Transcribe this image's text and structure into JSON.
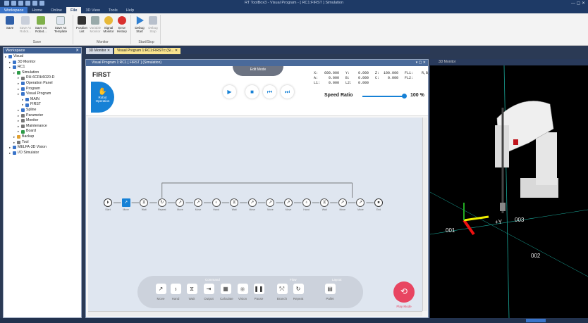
{
  "app": {
    "title": "RT ToolBox3 - Visual Program - [ RC1:FIRST ] Simulation",
    "menu_tabs": [
      "Workspace",
      "Home",
      "Online",
      "File",
      "3D View",
      "Tools",
      "Help"
    ]
  },
  "ribbon": {
    "groups": [
      {
        "label": "Save",
        "buttons": [
          "Save",
          "Save As Robot...",
          "Save As Robot...",
          "Save As Template"
        ]
      },
      {
        "label": "Monitor",
        "buttons": [
          "Position List",
          "Variable Monitor",
          "Signal Monitor",
          "Error History"
        ]
      },
      {
        "label": "Start/Stop",
        "buttons": [
          "Debug Start",
          "Debug Stop"
        ]
      }
    ]
  },
  "workspace": {
    "title": "Workspace",
    "tree": [
      {
        "label": "Visual",
        "depth": 0,
        "icon_color": "#3a74c9"
      },
      {
        "label": "3D Monitor",
        "depth": 1,
        "icon_color": "#3a74c9"
      },
      {
        "label": "RC1",
        "depth": 1,
        "icon_color": "#3a74c9"
      },
      {
        "label": "Simulation",
        "depth": 2,
        "icon_color": "#2e9b48"
      },
      {
        "label": "RH-6CRH6020-D",
        "depth": 3,
        "icon_color": "#777"
      },
      {
        "label": "Operation Panel",
        "depth": 3,
        "icon_color": "#3a74c9"
      },
      {
        "label": "Program",
        "depth": 3,
        "icon_color": "#3a74c9"
      },
      {
        "label": "Visual Program",
        "depth": 3,
        "icon_color": "#3a74c9"
      },
      {
        "label": "MAIN",
        "depth": 4,
        "icon_color": "#3a74c9"
      },
      {
        "label": "FIRST",
        "depth": 4,
        "icon_color": "#3a74c9"
      },
      {
        "label": "Spline",
        "depth": 3,
        "icon_color": "#3a74c9"
      },
      {
        "label": "Parameter",
        "depth": 3,
        "icon_color": "#777"
      },
      {
        "label": "Monitor",
        "depth": 3,
        "icon_color": "#777"
      },
      {
        "label": "Maintenance",
        "depth": 3,
        "icon_color": "#777"
      },
      {
        "label": "Board",
        "depth": 3,
        "icon_color": "#2e9b48"
      },
      {
        "label": "Backup",
        "depth": 2,
        "icon_color": "#e0a030"
      },
      {
        "label": "Tool",
        "depth": 2,
        "icon_color": "#777"
      },
      {
        "label": "MELFA-3D Vision",
        "depth": 1,
        "icon_color": "#3a74c9"
      },
      {
        "label": "I/O Simulator",
        "depth": 1,
        "icon_color": "#3a74c9"
      }
    ]
  },
  "doc_tabs": [
    {
      "label": "3D Monitor",
      "active": false
    },
    {
      "label": "Visual Program 1:RC1:FIRST:c (Si...",
      "active": true
    }
  ],
  "right_pane": {
    "title": "3D Monitor"
  },
  "visual_program": {
    "panel_title": "Visual Program 1:RC1 [ FIRST ] (Simulation)",
    "program_name": "FIRST",
    "mode": "Edit Mode",
    "robot_operation": "Robot Operation",
    "coords": "X:   600.000   Y:    0.000   Z:  100.000   FL1:    R,B,F\nA:     0.000   B:    0.000   C:    0.000   FL2:        0\nL1:    0.000   L2:   0.000",
    "speed_label": "Speed Ratio",
    "speed_ratio": 100,
    "speed_text": "100 %"
  },
  "flowchart": {
    "nodes": [
      {
        "glyph": "⏵",
        "label": "Start",
        "kind": "term"
      },
      {
        "glyph": "↗",
        "label": "Move",
        "kind": "sel"
      },
      {
        "glyph": "⧖",
        "label": "Wait",
        "kind": "node"
      },
      {
        "glyph": "↻",
        "label": "Repeat",
        "kind": "node"
      },
      {
        "glyph": "↗",
        "label": "Move",
        "kind": "node"
      },
      {
        "glyph": "↗",
        "label": "Move",
        "kind": "node"
      },
      {
        "glyph": "♁",
        "label": "Hand",
        "kind": "node"
      },
      {
        "glyph": "⧖",
        "label": "Wait",
        "kind": "node"
      },
      {
        "glyph": "↗",
        "label": "Move",
        "kind": "node"
      },
      {
        "glyph": "↗",
        "label": "Move",
        "kind": "node"
      },
      {
        "glyph": "↗",
        "label": "Move",
        "kind": "node"
      },
      {
        "glyph": "♁",
        "label": "Hand",
        "kind": "node"
      },
      {
        "glyph": "⧖",
        "label": "Wait",
        "kind": "node"
      },
      {
        "glyph": "↗",
        "label": "Move",
        "kind": "node"
      },
      {
        "glyph": "↗",
        "label": "Move",
        "kind": "node"
      },
      {
        "glyph": "⏹",
        "label": "End",
        "kind": "term"
      }
    ]
  },
  "palette": {
    "groups": [
      {
        "label": "Command"
      },
      {
        "label": "Flow"
      },
      {
        "label": "Layout"
      }
    ],
    "items": [
      {
        "glyph": "↗",
        "label": "Move",
        "enabled": true
      },
      {
        "glyph": "♁",
        "label": "Hand",
        "enabled": true
      },
      {
        "glyph": "⧖",
        "label": "Wait",
        "enabled": true
      },
      {
        "glyph": "⇥",
        "label": "Output",
        "enabled": true
      },
      {
        "glyph": "▦",
        "label": "Calculate",
        "enabled": true
      },
      {
        "glyph": "◉",
        "label": "Vision",
        "enabled": false
      },
      {
        "glyph": "❚❚",
        "label": "Pause",
        "enabled": true
      },
      {
        "glyph": "⤲",
        "label": "Branch",
        "enabled": true
      },
      {
        "glyph": "↻",
        "label": "Repeat",
        "enabled": true
      },
      {
        "glyph": "▤",
        "label": "Pallet",
        "enabled": true
      }
    ],
    "play_mode": "Play Mode"
  },
  "view3d": {
    "labels": [
      "+Y",
      "003",
      "001",
      "002"
    ]
  }
}
